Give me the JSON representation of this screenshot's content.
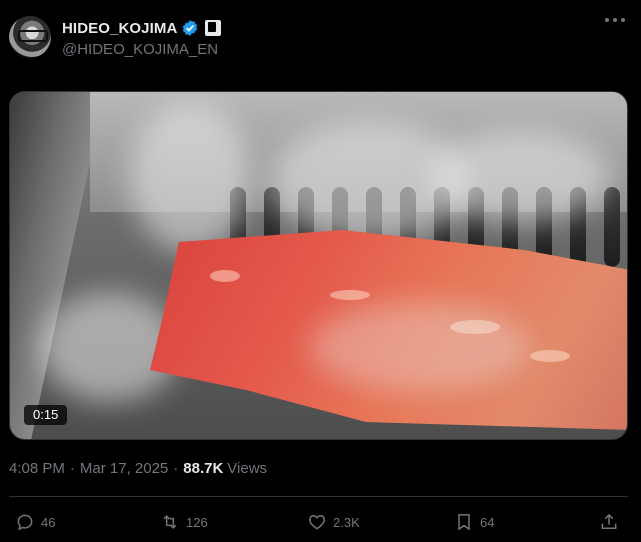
{
  "author": {
    "display_name": "HIDEO_KOJIMA",
    "handle": "@HIDEO_KOJIMA_EN",
    "verified_icon": "verified-badge-icon",
    "affiliation_icon": "affiliation-badge-icon"
  },
  "media": {
    "duration": "0:15"
  },
  "post_meta": {
    "time": "4:08 PM",
    "separator": "·",
    "date": "Mar 17, 2025",
    "views_count": "88.7K",
    "views_label": "Views"
  },
  "actions": {
    "replies": "46",
    "reposts": "126",
    "likes": "2.3K",
    "bookmarks": "64"
  },
  "colors": {
    "background": "#000000",
    "text": "#e7e9ea",
    "muted": "#71767b",
    "verified": "#1d9bf0",
    "border": "#2f3336"
  }
}
